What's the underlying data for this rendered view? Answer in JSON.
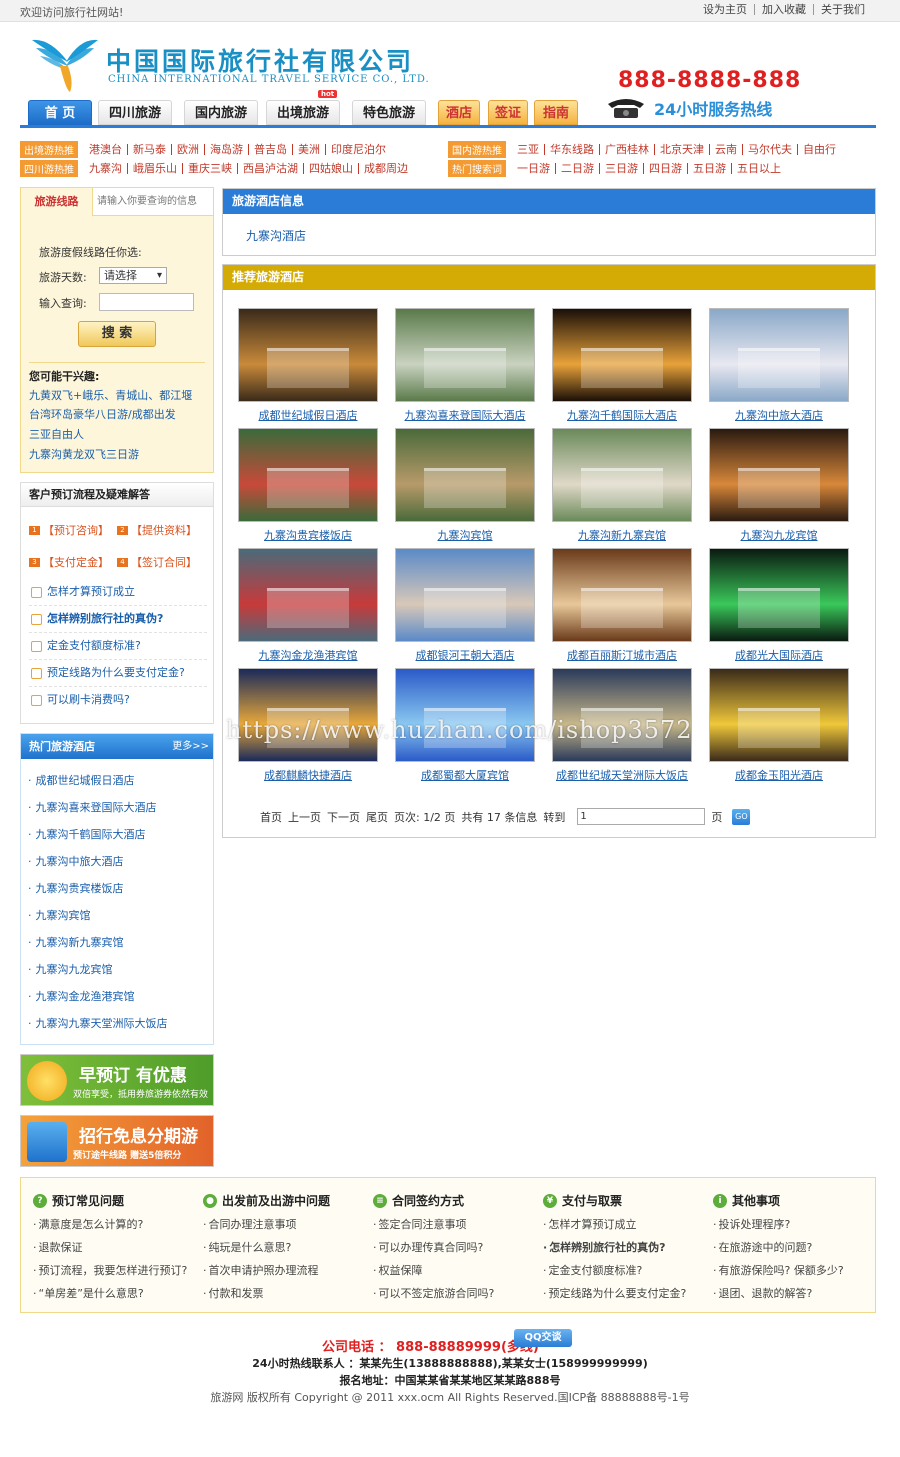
{
  "topbar": {
    "welcome": "欢迎访问旅行社网站!",
    "links": [
      "设为主页",
      "加入收藏",
      "关于我们"
    ]
  },
  "header": {
    "company_cn": "中国国际旅行社有限公司",
    "company_en": "CHINA INTERNATIONAL TRAVEL SERVICE CO., LTD.",
    "hotline_number": "888-8888-888",
    "hotline_label": "24小时服务热线"
  },
  "nav": {
    "items": [
      "首 页",
      "四川旅游",
      "国内旅游",
      "出境旅游",
      "特色旅游"
    ],
    "hot_badge": "hot",
    "orange_items": [
      "酒店",
      "签证",
      "指南"
    ]
  },
  "hotlinks": {
    "row1_tag": "出境游热推",
    "row1": [
      "港澳台",
      "新马泰",
      "欧洲",
      "海岛游",
      "普吉岛",
      "美洲",
      "印度尼泊尔"
    ],
    "row1b_tag": "国内游热推",
    "row1b": [
      "三亚",
      "华东线路",
      "广西桂林",
      "北京天津",
      "云南",
      "马尔代夫",
      "自由行"
    ],
    "row2_tag": "四川游热推",
    "row2": [
      "九寨沟",
      "峨眉乐山",
      "重庆三峡",
      "西昌泸沽湖",
      "四姑娘山",
      "成都周边"
    ],
    "row2b_tag": "热门搜索词",
    "row2b": [
      "一日游",
      "二日游",
      "三日游",
      "四日游",
      "五日游",
      "五日以上"
    ]
  },
  "search": {
    "tab_active": "旅游线路",
    "tab_placeholder": "请输入你要查询的信息",
    "hint": "旅游度假线路任你选:",
    "days_label": "旅游天数:",
    "days_value": "请选择",
    "query_label": "输入查询:",
    "query_value": "",
    "button": "搜 索",
    "interest_title": "您可能干兴趣:",
    "interests": [
      "九黄双飞+峨乐、青城山、都江堰",
      "台湾环岛豪华八日游/成都出发",
      "三亚自由人",
      "九寨沟黄龙双飞三日游"
    ]
  },
  "booking": {
    "title": "客户预订流程及疑难解答",
    "steps": [
      "【预订咨询】",
      "【提供资料】",
      "【支付定金】",
      "【签订合同】"
    ],
    "faqs": [
      "怎样才算预订成立",
      "怎样辨别旅行社的真伪?",
      "定金支付额度标准?",
      "预定线路为什么要支付定金?",
      "可以刷卡消费吗?"
    ]
  },
  "hot_hotels": {
    "title": "热门旅游酒店",
    "more": "更多>>",
    "items": [
      "成都世纪城假日酒店",
      "九寨沟喜来登国际大酒店",
      "九寨沟千鹤国际大酒店",
      "九寨沟中旅大酒店",
      "九寨沟贵宾楼饭店",
      "九寨沟宾馆",
      "九寨沟新九寨宾馆",
      "九寨沟九龙宾馆",
      "九寨沟金龙渔港宾馆",
      "九寨沟九寨天堂洲际大饭店"
    ]
  },
  "banners": {
    "b1_big": "早预订 有优惠",
    "b1_small": "双倍享受，抵用券旅游券依然有效",
    "b2_big": "招行免息分期游",
    "b2_small": "预订途牛线路 赠送5倍积分"
  },
  "hotel_info": {
    "title": "旅游酒店信息",
    "link": "九寨沟酒店"
  },
  "recommend": {
    "title": "推荐旅游酒店",
    "hotels": [
      {
        "name": "成都世纪城假日酒店",
        "c1": "#3a2a1a",
        "c2": "#c98a3a"
      },
      {
        "name": "九寨沟喜来登国际大酒店",
        "c1": "#5a7a4a",
        "c2": "#c9d2c0"
      },
      {
        "name": "九寨沟千鹤国际大酒店",
        "c1": "#1a0f08",
        "c2": "#e8a23a"
      },
      {
        "name": "九寨沟中旅大酒店",
        "c1": "#8aa8c8",
        "c2": "#e8e8f0"
      },
      {
        "name": "九寨沟贵宾楼饭店",
        "c1": "#3a6a3a",
        "c2": "#c84a3a"
      },
      {
        "name": "九寨沟宾馆",
        "c1": "#4a6a3a",
        "c2": "#b89a6a"
      },
      {
        "name": "九寨沟新九寨宾馆",
        "c1": "#6a8a5a",
        "c2": "#e0d8c8"
      },
      {
        "name": "九寨沟九龙宾馆",
        "c1": "#2a1a10",
        "c2": "#d8883a"
      },
      {
        "name": "九寨沟金龙渔港宾馆",
        "c1": "#4a6a7a",
        "c2": "#c83a3a"
      },
      {
        "name": "成都银河王朝大酒店",
        "c1": "#5a8ac8",
        "c2": "#d8c8b8"
      },
      {
        "name": "成都百丽斯汀城市酒店",
        "c1": "#6a3a1a",
        "c2": "#e8c89a"
      },
      {
        "name": "成都光大国际酒店",
        "c1": "#0a1a10",
        "c2": "#3ac85a"
      },
      {
        "name": "成都麒麟快捷酒店",
        "c1": "#1a2a5a",
        "c2": "#e8a83a"
      },
      {
        "name": "成都蜀都大厦宾馆",
        "c1": "#2a5ac8",
        "c2": "#8ac8f0"
      },
      {
        "name": "成都世纪城天堂洲际大饭店",
        "c1": "#2a3a5a",
        "c2": "#c8b88a"
      },
      {
        "name": "成都金玉阳光酒店",
        "c1": "#3a2a1a",
        "c2": "#f0c83a"
      }
    ]
  },
  "pager": {
    "first": "首页",
    "prev": "上一页",
    "next": "下一页",
    "last": "尾页",
    "pages": "页次: 1/2 页",
    "total": "共有 17 条信息",
    "goto": "转到",
    "page_input": "1",
    "page_unit": "页",
    "go": "GO"
  },
  "watermark": "https://www.huzhan.com/ishop3572",
  "help": {
    "cols": [
      {
        "title": "预订常见问题",
        "items": [
          "满意度是怎么计算的?",
          "退款保证",
          "预订流程，我要怎样进行预订?",
          "“单房差”是什么意思?"
        ]
      },
      {
        "title": "出发前及出游中问题",
        "items": [
          "合同办理注意事项",
          "纯玩是什么意思?",
          "首次申请护照办理流程",
          "付款和发票"
        ]
      },
      {
        "title": "合同签约方式",
        "items": [
          "签定合同注意事项",
          "可以办理传真合同吗?",
          "权益保障",
          "可以不签定旅游合同吗?"
        ]
      },
      {
        "title": "支付与取票",
        "items": [
          "怎样才算预订成立",
          "怎样辨别旅行社的真伪?",
          "定金支付额度标准?",
          "预定线路为什么要支付定金?"
        ]
      },
      {
        "title": "其他事项",
        "items": [
          "投诉处理程序?",
          "在旅游途中的问题?",
          "有旅游保险吗? 保额多少?",
          "退团、退款的解答?"
        ]
      }
    ]
  },
  "footer": {
    "company_phone": "公司电话 ： 888-88889999(多线)",
    "qq": "QQ交谈",
    "contact": "24小时热线联系人 ：某某先生(13888888888),某某女士(158999999999)",
    "address": "报名地址：中国某某省某某地区某某路888号",
    "copyright": "旅游网 版权所有 Copyright @ 2011 xxx.ocm All Rights Reserved.国ICP备 88888888号-1号"
  }
}
